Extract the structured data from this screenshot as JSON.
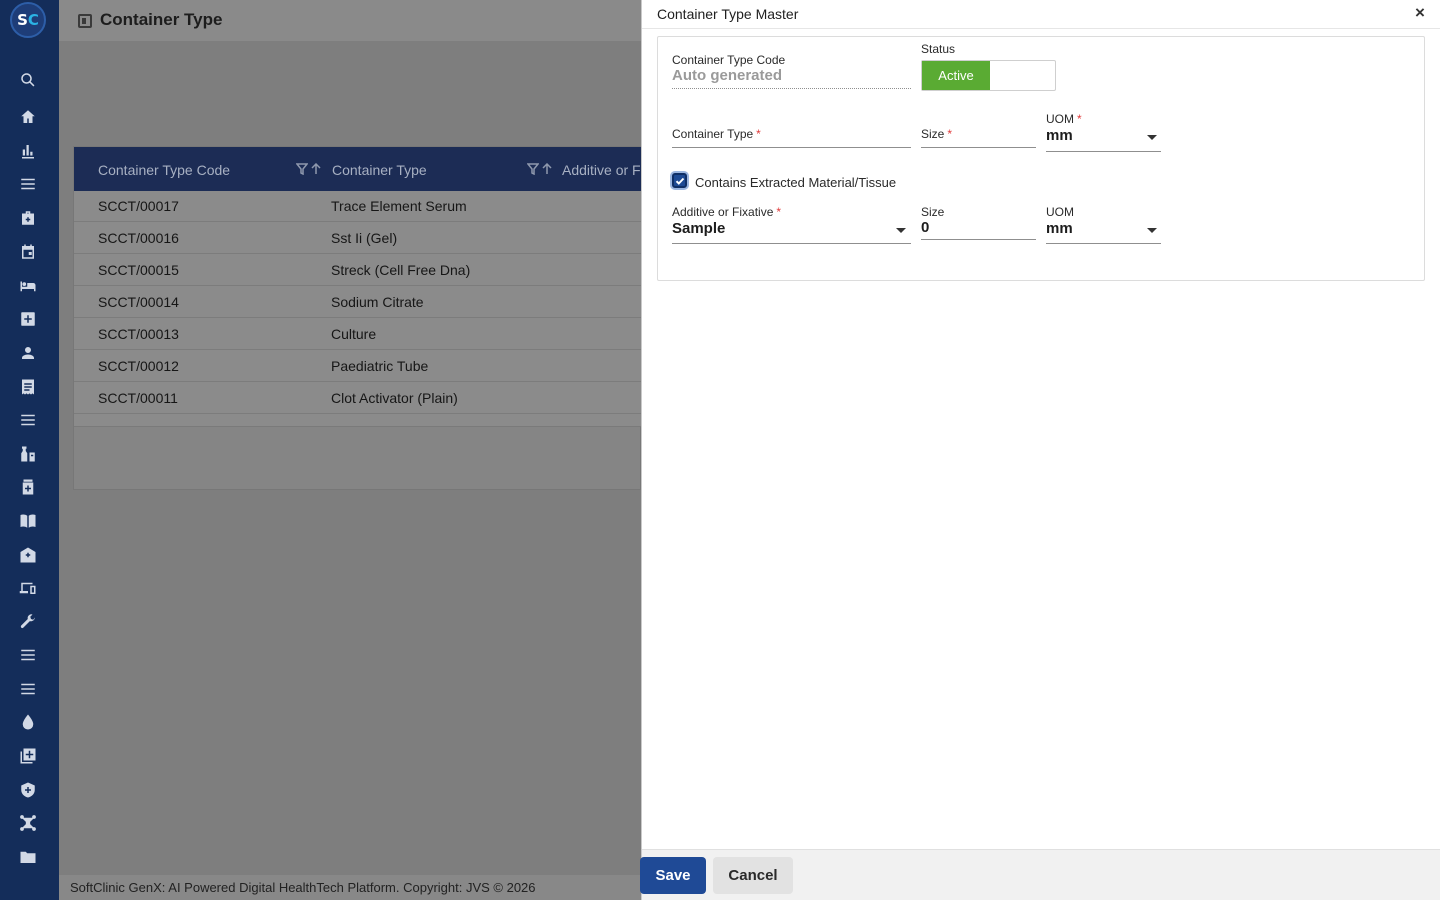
{
  "app": {
    "logo_left": "S",
    "logo_right": "C",
    "page_title": "Container Type",
    "footer_text": "SoftClinic GenX: AI Powered Digital HealthTech Platform. Copyright: JVS © 2026"
  },
  "sidebar": {
    "icons": [
      "search-icon",
      "home-icon",
      "chart-icon",
      "menu-icon",
      "briefcase-medical-icon",
      "calendar-icon",
      "bed-icon",
      "plus-square-icon",
      "user-icon",
      "receipt-icon",
      "list-icon",
      "pharmacy-icon",
      "medicine-box-icon",
      "book-icon",
      "hospital-icon",
      "devices-icon",
      "wrench-icon",
      "menu-icon",
      "menu-icon",
      "drop-icon",
      "add-library-icon",
      "shield-icon",
      "network-icon",
      "folder-icon"
    ]
  },
  "grid": {
    "columns": [
      "Container Type Code",
      "Container Type",
      "Additive or Fi"
    ],
    "rows": [
      {
        "code": "SCCT/00017",
        "type": "Trace Element Serum"
      },
      {
        "code": "SCCT/00016",
        "type": "Sst Ii (Gel)"
      },
      {
        "code": "SCCT/00015",
        "type": "Streck (Cell Free Dna)"
      },
      {
        "code": "SCCT/00014",
        "type": "Sodium Citrate"
      },
      {
        "code": "SCCT/00013",
        "type": "Culture"
      },
      {
        "code": "SCCT/00012",
        "type": "Paediatric Tube"
      },
      {
        "code": "SCCT/00011",
        "type": "Clot Activator (Plain)"
      }
    ]
  },
  "modal": {
    "title": "Container Type Master",
    "close_label": "×",
    "fields": {
      "code_label": "Container Type Code",
      "code_value": "Auto generated",
      "status_label": "Status",
      "status_value": "Active",
      "container_type_label": "Container Type",
      "container_type_value": "",
      "size_label": "Size",
      "size_value": "",
      "uom_label": "UOM",
      "uom_value": "mm",
      "checkbox_label": "Contains Extracted Material/Tissue",
      "checkbox_checked": true,
      "additive_label": "Additive or Fixative",
      "additive_value": "Sample",
      "size2_label": "Size",
      "size2_value": "0",
      "uom2_label": "UOM",
      "uom2_value": "mm",
      "required_mark": "*"
    },
    "save_label": "Save",
    "cancel_label": "Cancel"
  },
  "colors": {
    "sidebar": "#142d5a",
    "grid_header": "#1c2c55",
    "active_green": "#5aab33",
    "primary_button": "#1f4a96",
    "required": "#e03a3a"
  }
}
